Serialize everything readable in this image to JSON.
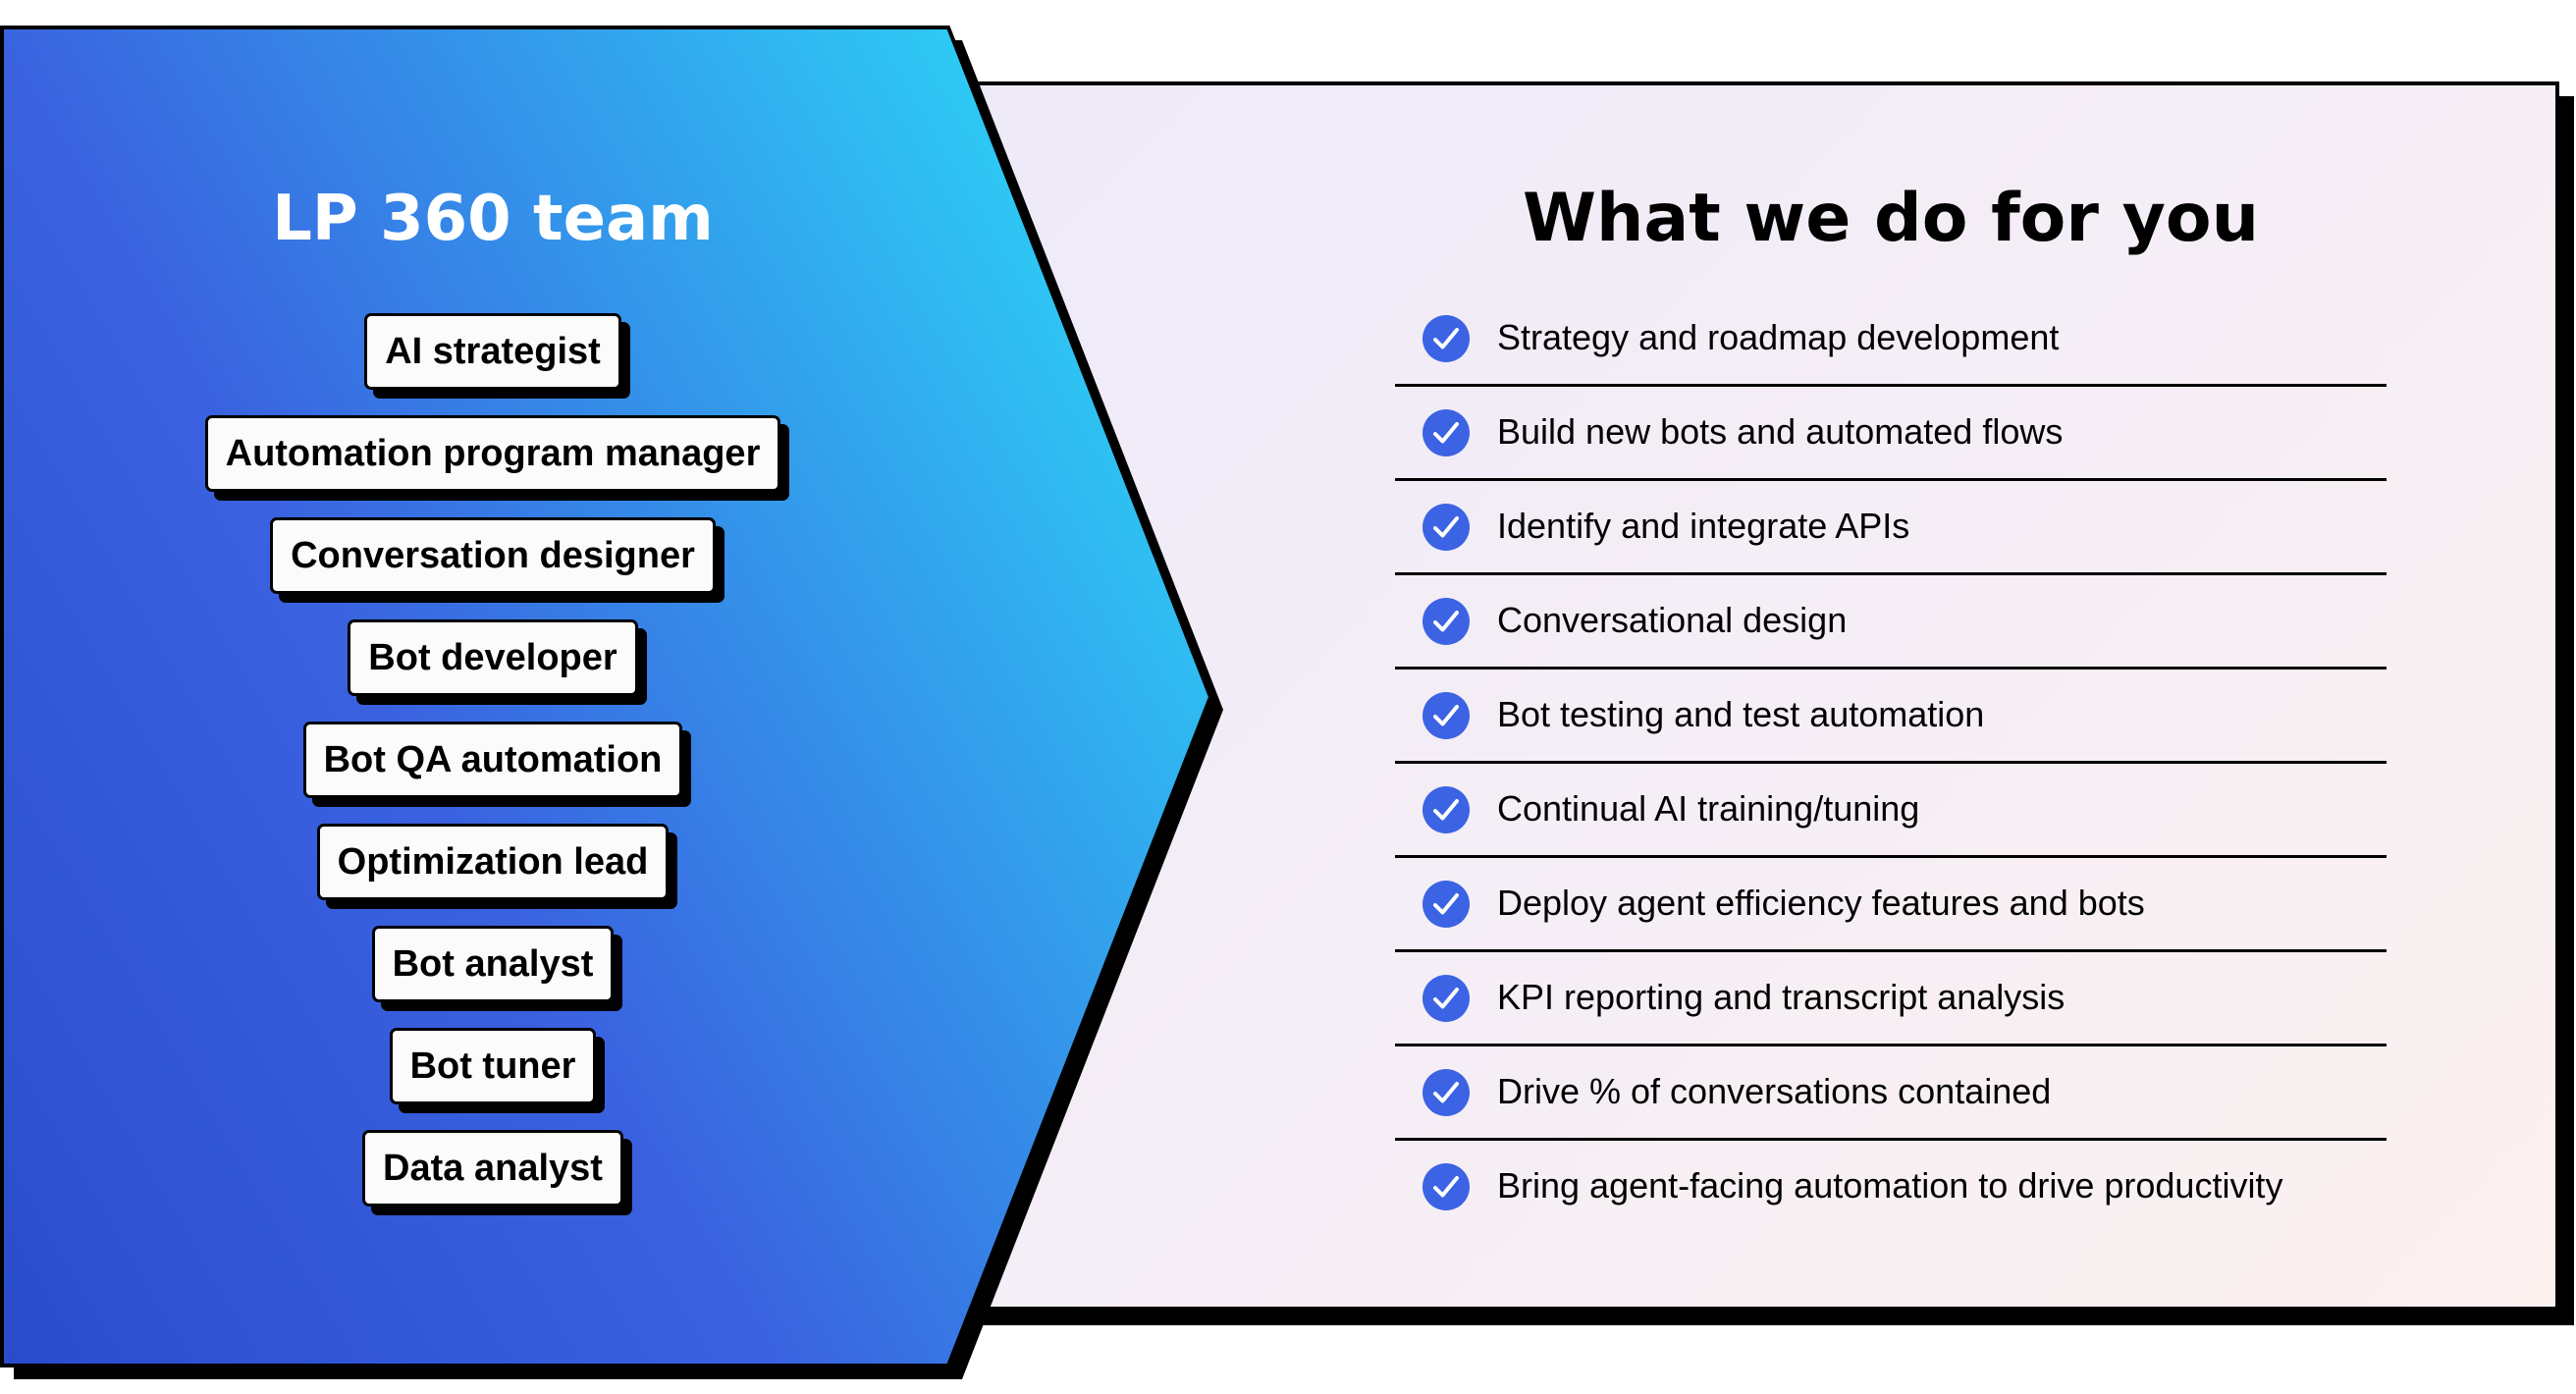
{
  "colors": {
    "gradient_start": "#2a4ccc",
    "gradient_mid": "#3a62e0",
    "gradient_end": "#2ec8f4",
    "right_bg_start": "#eeeaf8",
    "right_bg_end": "#fbf1ef",
    "check_fill": "#3b63e3",
    "outline": "#000000"
  },
  "team": {
    "title": "LP 360 team",
    "roles": [
      {
        "label": "AI strategist"
      },
      {
        "label": "Automation program manager"
      },
      {
        "label": "Conversation designer"
      },
      {
        "label": "Bot developer"
      },
      {
        "label": "Bot QA automation"
      },
      {
        "label": "Optimization lead"
      },
      {
        "label": "Bot analyst"
      },
      {
        "label": "Bot tuner"
      },
      {
        "label": "Data analyst"
      }
    ]
  },
  "services": {
    "title": "What we do for you",
    "icon": "check-circle-icon",
    "items": [
      {
        "label": "Strategy and roadmap development"
      },
      {
        "label": "Build new bots and automated flows"
      },
      {
        "label": "Identify and integrate APIs"
      },
      {
        "label": "Conversational design"
      },
      {
        "label": "Bot testing and test automation"
      },
      {
        "label": "Continual AI training/tuning"
      },
      {
        "label": "Deploy agent efficiency features and bots"
      },
      {
        "label": "KPI reporting and transcript analysis"
      },
      {
        "label": "Drive % of conversations contained"
      },
      {
        "label": "Bring agent-facing automation to drive productivity"
      }
    ]
  }
}
